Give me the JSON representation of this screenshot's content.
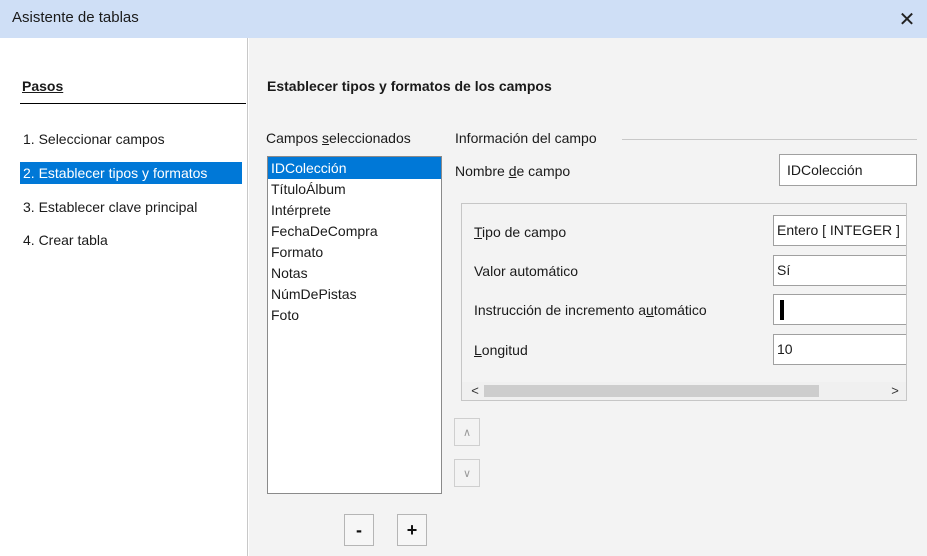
{
  "window": {
    "title": "Asistente de tablas",
    "close_glyph": "✕"
  },
  "steps": {
    "title": "Pasos",
    "items": [
      {
        "label": "1. Seleccionar campos",
        "active": false
      },
      {
        "label": "2. Establecer tipos y formatos",
        "active": true
      },
      {
        "label": "3. Establecer clave principal",
        "active": false
      },
      {
        "label": "4. Crear tabla",
        "active": false
      }
    ]
  },
  "main": {
    "section_title": "Establecer tipos y formatos de los campos",
    "fields": {
      "label_pre": "Campos ",
      "label_mn": "s",
      "label_post": "eleccionados",
      "items": [
        "IDColección",
        "TítuloÁlbum",
        "Intérprete",
        "FechaDeCompra",
        "Formato",
        "Notas",
        "NúmDePistas",
        "Foto"
      ],
      "selected_index": 0,
      "remove_label": "-",
      "add_label": "+"
    },
    "info": {
      "legend": "Información del campo",
      "field_name_pre": "Nombre ",
      "field_name_mn": "d",
      "field_name_post": "e campo",
      "field_name_value": "IDColección",
      "props": {
        "tipo_mn": "T",
        "tipo_post": "ipo de campo",
        "tipo_value": "Entero [ INTEGER ]",
        "valor_label": "Valor automático",
        "valor_value": "Sí",
        "instr_pre": "Instrucción de incremento a",
        "instr_mn": "u",
        "instr_post": "tomático",
        "instr_value": "",
        "long_mn": "L",
        "long_post": "ongitud",
        "long_value": "10"
      },
      "scroll_left": "<",
      "scroll_right": ">"
    },
    "move_up_glyph": "∧",
    "move_down_glyph": "∨"
  }
}
